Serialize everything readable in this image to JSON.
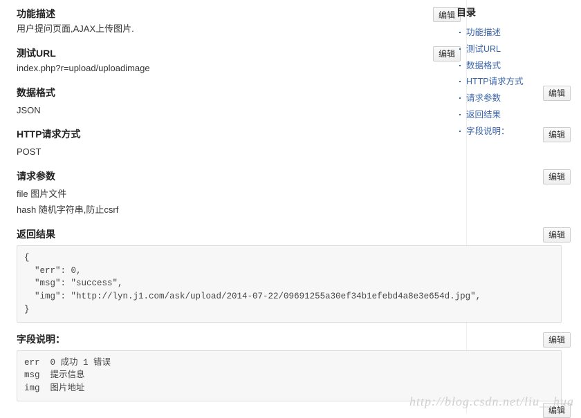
{
  "editLabel": "编辑",
  "sections": [
    {
      "id": "s_func",
      "title": "功能描述",
      "body": "用户提问页面,AJAX上传图片.",
      "editPos": "inline"
    },
    {
      "id": "s_url",
      "title": "测试URL",
      "body": "index.php?r=upload/uploadimage",
      "editPos": "inline"
    },
    {
      "id": "s_fmt",
      "title": "数据格式",
      "body": "JSON",
      "editPos": "side"
    },
    {
      "id": "s_http",
      "title": "HTTP请求方式",
      "body": "POST",
      "editPos": "side"
    },
    {
      "id": "s_req",
      "title": "请求参数",
      "lines": [
        "file 图片文件",
        "",
        "hash 随机字符串,防止csrf"
      ],
      "editPos": "side"
    },
    {
      "id": "s_ret",
      "title": "返回结果",
      "code": "{\n  \"err\": 0,\n  \"msg\": \"success\",\n  \"img\": \"http://lyn.j1.com/ask/upload/2014-07-22/09691255a30ef34b1efebd4a8e3e654d.jpg\",\n}",
      "editPos": "side"
    },
    {
      "id": "s_fld",
      "title": "字段说明：",
      "code": "err  0 成功 1 错误\nmsg  提示信息\nimg  图片地址",
      "editPos": "side",
      "editAfter": true
    }
  ],
  "toc": {
    "title": "目录",
    "items": [
      "功能描述",
      "测试URL",
      "数据格式",
      "HTTP请求方式",
      "请求参数",
      "返回结果",
      "字段说明："
    ]
  },
  "watermark": "http://blog.csdn.net/liu__hua"
}
